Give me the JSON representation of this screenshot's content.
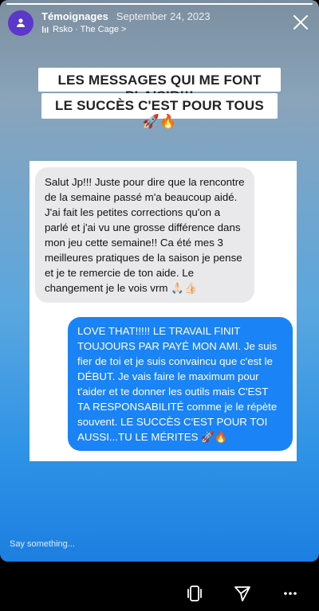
{
  "story": {
    "progress": 1.0
  },
  "header": {
    "account_name": "Témoignages",
    "date": "September 24, 2023",
    "music": "Rsko · The Cage >"
  },
  "title": {
    "line1": "LES MESSAGES QUI ME FONT PLAISIR!!!",
    "line2": "LE SUCCÈS C'EST POUR TOUS 🚀🔥"
  },
  "chat": {
    "incoming": "Salut Jp!!! Juste pour dire que la rencontre de la semaine passé m'a beaucoup aidé. J'ai fait les petites corrections qu'on a parlé et j'ai vu une grosse différence dans mon jeu cette semaine!! Ca été mes 3 meilleures pratiques de la saison je pense et je te remercie de ton aide. Le changement je le vois vrm 🙏🏻👍🏻",
    "outgoing": "LOVE THAT!!!!! LE TRAVAIL FINIT TOUJOURS PAR PAYÉ MON AMI. Je suis fier de toi et je suis convaincu que c'est le DÉBUT. Je vais faire le maximum pour t'aider et te donner les outils mais C'EST TA RESPONSABILITÉ comme je le répète souvent. LE SUCCÈS C'EST POUR TOI AUSSI...TU LE MÉRITES 🚀🔥"
  },
  "reply": {
    "placeholder": "Say something..."
  },
  "icons": {
    "avatar": "people-group-icon",
    "close": "close-icon",
    "music": "music-note-icon",
    "share": "send-icon",
    "more": "more-icon",
    "remix": "remix-icon"
  }
}
